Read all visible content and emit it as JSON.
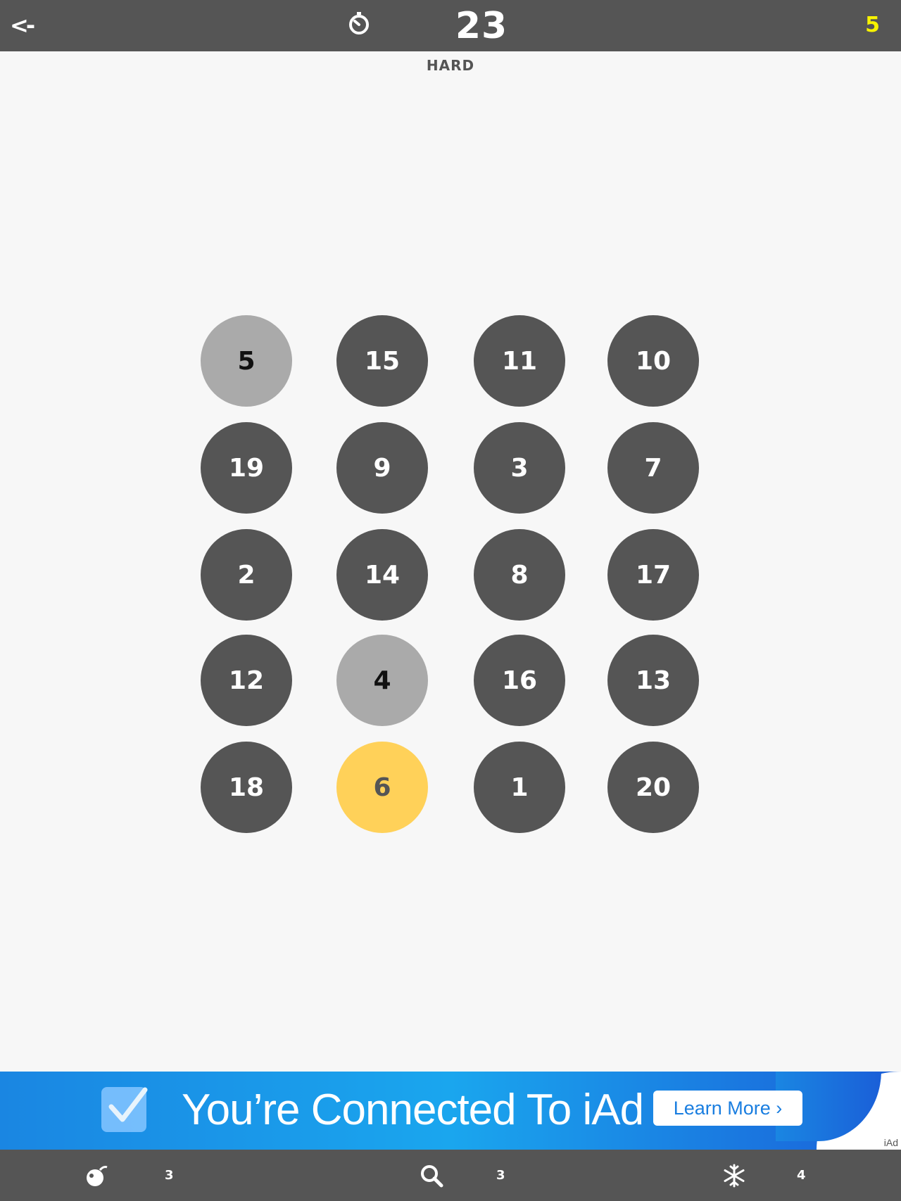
{
  "header": {
    "back_label": "<-",
    "timer_icon": "stopwatch-icon",
    "timer_value": "23",
    "score": "5",
    "score_color": "#f7f200"
  },
  "difficulty": "HARD",
  "colors": {
    "tile_default": "#555555",
    "tile_found": "#aaaaaa",
    "tile_target": "#ffd159",
    "text_default": "#ffffff",
    "text_found": "#111111",
    "text_target": "#555555"
  },
  "board": {
    "rows": 5,
    "cols": 4,
    "tiles": [
      {
        "number": "5",
        "state": "found"
      },
      {
        "number": "15",
        "state": "default"
      },
      {
        "number": "11",
        "state": "default"
      },
      {
        "number": "10",
        "state": "default"
      },
      {
        "number": "19",
        "state": "default"
      },
      {
        "number": "9",
        "state": "default"
      },
      {
        "number": "3",
        "state": "default"
      },
      {
        "number": "7",
        "state": "default"
      },
      {
        "number": "2",
        "state": "default"
      },
      {
        "number": "14",
        "state": "default"
      },
      {
        "number": "8",
        "state": "default"
      },
      {
        "number": "17",
        "state": "default"
      },
      {
        "number": "12",
        "state": "default"
      },
      {
        "number": "4",
        "state": "found"
      },
      {
        "number": "16",
        "state": "default"
      },
      {
        "number": "13",
        "state": "default"
      },
      {
        "number": "18",
        "state": "default"
      },
      {
        "number": "6",
        "state": "target"
      },
      {
        "number": "1",
        "state": "default"
      },
      {
        "number": "20",
        "state": "default"
      }
    ]
  },
  "ad": {
    "text": "You’re Connected To iAd",
    "button_label": "Learn More ›",
    "badge": "iAd"
  },
  "powerups": [
    {
      "icon": "bomb-icon",
      "count": "3"
    },
    {
      "icon": "magnifier-icon",
      "count": "3"
    },
    {
      "icon": "snowflake-icon",
      "count": "4"
    }
  ]
}
